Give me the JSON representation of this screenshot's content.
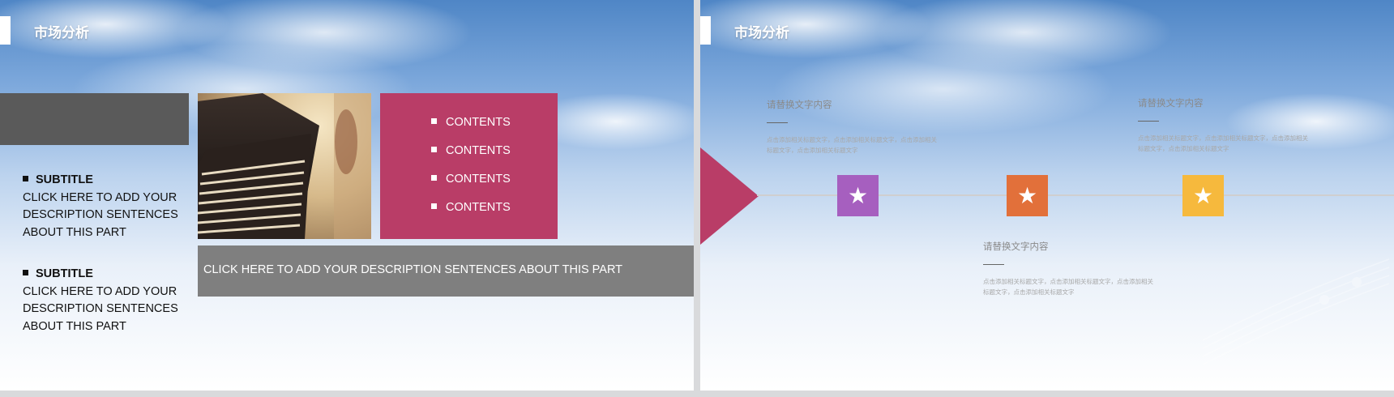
{
  "slides": [
    {
      "title": "市场分析",
      "left_blocks": [
        {
          "subtitle": "SUBTITLE",
          "description": "CLICK HERE TO ADD YOUR DESCRIPTION SENTENCES ABOUT THIS PART"
        },
        {
          "subtitle": "SUBTITLE",
          "description": "CLICK HERE TO ADD YOUR DESCRIPTION SENTENCES ABOUT THIS PART"
        }
      ],
      "contents": [
        "CONTENTS",
        "CONTENTS",
        "CONTENTS",
        "CONTENTS"
      ],
      "bottom_description": "CLICK HERE TO ADD YOUR DESCRIPTION SENTENCES ABOUT THIS PART",
      "colors": {
        "pink": "#b93d67",
        "dark_gray": "#5a5a5a",
        "mid_gray": "#7f7f7f"
      },
      "photo_icon": "piano-photo"
    },
    {
      "title": "市场分析",
      "stars": [
        {
          "icon": "star-icon",
          "color": "#a65fbf"
        },
        {
          "icon": "star-icon",
          "color": "#e2703a"
        },
        {
          "icon": "star-icon",
          "color": "#f6b93d"
        }
      ],
      "text_groups": [
        {
          "heading": "请替换文字内容",
          "body": "点击添加相关标题文字，点击添加相关标题文字，点击添加相关标题文字，点击添加相关标题文字"
        },
        {
          "heading": "请替换文字内容",
          "body": "点击添加相关标题文字，点击添加相关标题文字，点击添加相关标题文字，点击添加相关标题文字"
        },
        {
          "heading": "请替换文字内容",
          "body": "点击添加相关标题文字，点击添加相关标题文字，点击添加相关标题文字，点击添加相关标题文字"
        }
      ],
      "arrow_color": "#b93d67"
    }
  ]
}
